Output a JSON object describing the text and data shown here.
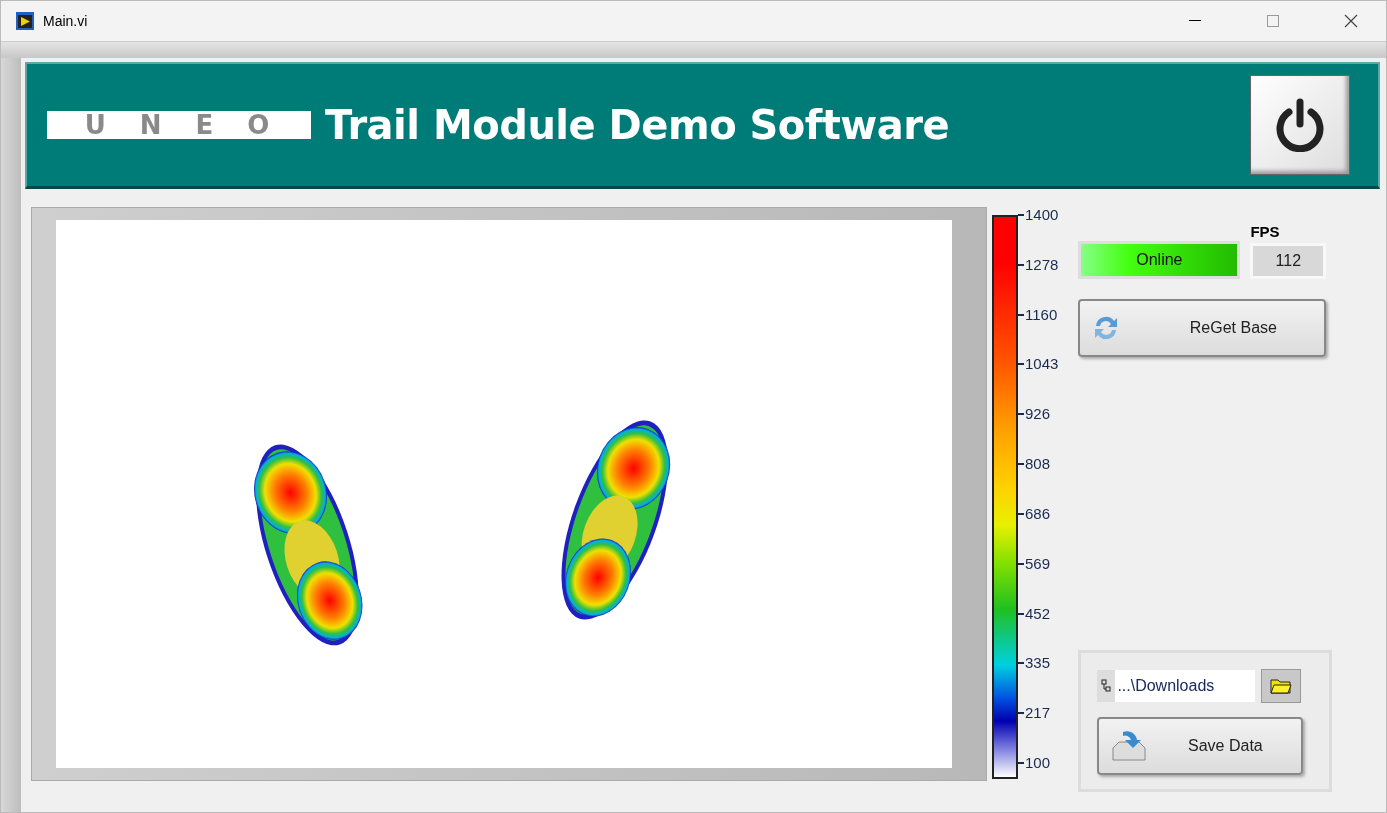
{
  "window": {
    "title": "Main.vi"
  },
  "header": {
    "logo": "UNEO",
    "title": "Trail Module Demo Software"
  },
  "scale": {
    "ticks": [
      "1400",
      "1278",
      "1160",
      "1043",
      "926",
      "808",
      "686",
      "569",
      "452",
      "335",
      "217",
      "100"
    ]
  },
  "status": {
    "label": "Online",
    "on": true
  },
  "fps": {
    "label": "FPS",
    "value": "112"
  },
  "reget_button": {
    "label": "ReGet Base"
  },
  "path_field": {
    "value": "...\\Downloads"
  },
  "save_button": {
    "label": "Save Data"
  }
}
